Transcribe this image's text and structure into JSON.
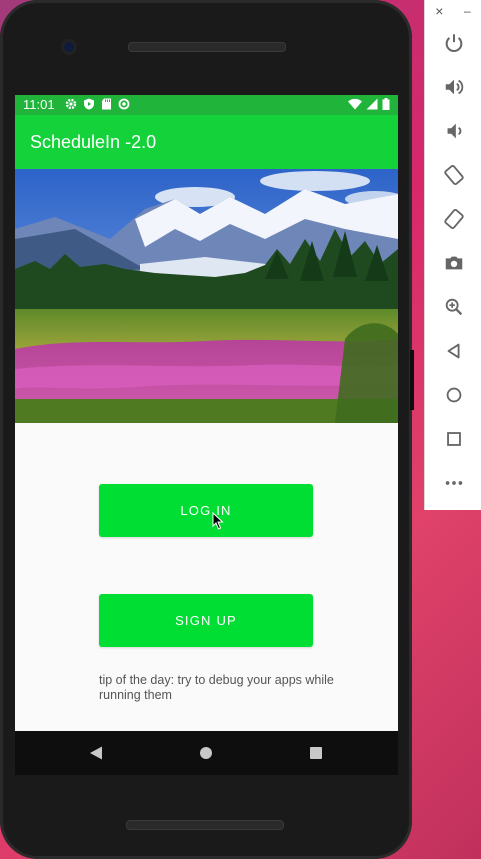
{
  "statusbar": {
    "time": "11:01"
  },
  "app": {
    "title": "ScheduleIn -2.0"
  },
  "buttons": {
    "login": "LOG IN",
    "signup": "SIGN UP"
  },
  "tip": {
    "text": "tip of the day: try to debug your apps while running them"
  },
  "emulator": {
    "close_glyph": "×",
    "minimize_glyph": "–",
    "tools": [
      "power-icon",
      "volume-up-icon",
      "volume-down-icon",
      "rotate-left-icon",
      "rotate-right-icon",
      "camera-icon",
      "zoom-icon",
      "back-icon",
      "home-icon",
      "overview-icon",
      "more-icon"
    ]
  },
  "colors": {
    "statusbar": "#20b43a",
    "appbar": "#14d23a",
    "button": "#00dd33"
  }
}
